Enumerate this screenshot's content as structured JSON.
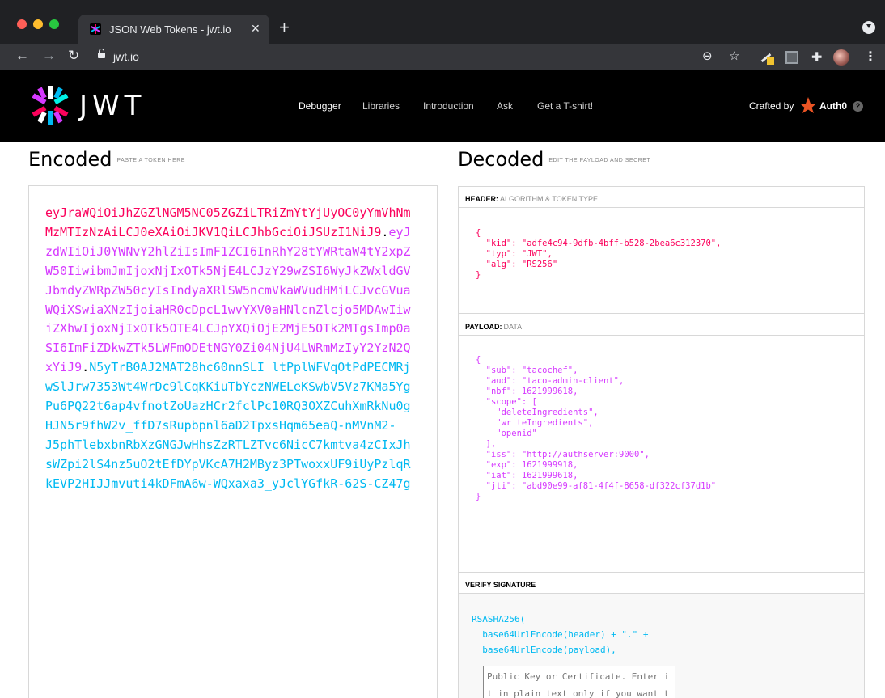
{
  "browser": {
    "tab_title": "JSON Web Tokens - jwt.io",
    "url": "jwt.io"
  },
  "site": {
    "logo_text": "JWT",
    "nav": [
      "Debugger",
      "Libraries",
      "Introduction",
      "Ask",
      "Get a T-shirt!"
    ],
    "crafted_by": "Crafted by",
    "auth0": "Auth0"
  },
  "encoded": {
    "title": "Encoded",
    "subtitle": "PASTE A TOKEN HERE",
    "header_part": "eyJraWQiOiJhZGZlNGM5NC05ZGZiLTRiZmYtYjUyOC0yYmVhNmMzMTIzNzAiLCJ0eXAiOiJKV1QiLCJhbGciOiJSUzI1NiJ9",
    "payload_part": "eyJzdWIiOiJ0YWNvY2hlZiIsImF1ZCI6InRhY28tYWRtaW4tY2xpZW50IiwibmJmIjoxNjIxOTk5NjE4LCJzY29wZSI6WyJkZWxldGVJbmdyZWRpZW50cyIsIndyaXRlSW5ncmVkaWVudHMiLCJvcGVuaWQiXSwiaXNzIjoiaHR0cDpcL1wvYXV0aHNlcnZlcjo5MDAwIiwiZXhwIjoxNjIxOTk5OTE4LCJpYXQiOjE2MjE5OTk2MTgsImp0aSI6ImFiZDkwZTk5LWFmODEtNGY0Zi04NjU4LWRmMzIyY2YzN2QxYiJ9",
    "signature_part": "N5yTrB0AJ2MAT28hc60nnSLI_ltPplWFVqOtPdPECMRjwSlJrw7353Wt4WrDc9lCqKKiuTbYczNWELeKSwbV5Vz7KMa5YgPu6PQ22t6ap4vfnotZoUazHCr2fclPc10RQ3OXZCuhXmRkNu0gHJN5r9fhW2v_ffD7sRupbpnl6aD2TpxsHqm65eaQ-nMVnM2-\nJ5phTlebxbnRbXzGNGJwHhsZzRTLZTvc6NicC7kmtva4zCIxJhsWZpi2lS4nz5uO2tEfDYpVKcA7H2MByz3PTwoxxUF9iUyPzlqRkEVP2HIJJmvuti4kDFmA6w-WQxaxa3_yJclYGfkR-62S-CZ47g"
  },
  "decoded": {
    "title": "Decoded",
    "subtitle": "EDIT THE PAYLOAD AND SECRET",
    "header_label": "HEADER:",
    "header_sub": "ALGORITHM & TOKEN TYPE",
    "header_json": "{\n  \"kid\": \"adfe4c94-9dfb-4bff-b528-2bea6c312370\",\n  \"typ\": \"JWT\",\n  \"alg\": \"RS256\"\n}",
    "payload_label": "PAYLOAD:",
    "payload_sub": "DATA",
    "payload_json": "{\n  \"sub\": \"tacochef\",\n  \"aud\": \"taco-admin-client\",\n  \"nbf\": 1621999618,\n  \"scope\": [\n    \"deleteIngredients\",\n    \"writeIngredients\",\n    \"openid\"\n  ],\n  \"iss\": \"http://authserver:9000\",\n  \"exp\": 1621999918,\n  \"iat\": 1621999618,\n  \"jti\": \"abd90e99-af81-4f4f-8658-df322cf37d1b\"\n}",
    "verify_label": "VERIFY SIGNATURE",
    "verify_code": "RSASHA256(\n  base64UrlEncode(header) + \".\" +\n  base64UrlEncode(payload),",
    "public_key_placeholder": "Public Key or Certificate. Enter it in plain text only if you want to verify a token"
  },
  "colors": {
    "header": "#fb015b",
    "payload": "#d63aff",
    "signature": "#00b9f1"
  },
  "icons": [
    "back-arrow-icon",
    "forward-arrow-icon",
    "reload-icon",
    "lock-icon",
    "zoom-icon",
    "star-icon",
    "extension-icon",
    "puzzle-icon",
    "profile-avatar",
    "menu-dots-icon",
    "jwt-logo",
    "auth0-logo",
    "help-icon"
  ]
}
